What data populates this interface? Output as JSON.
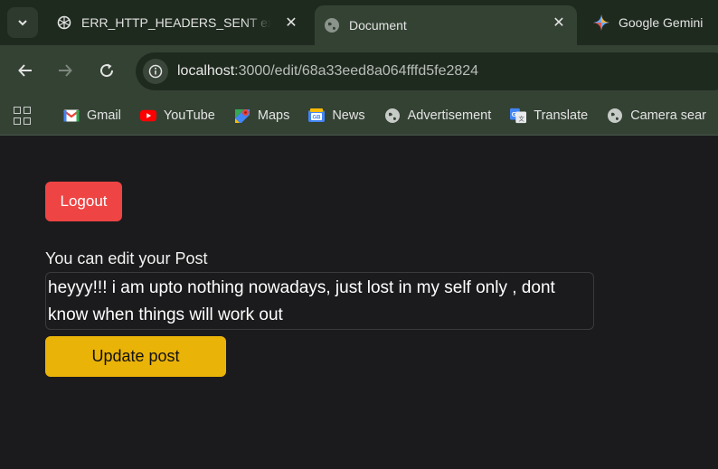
{
  "browser": {
    "tabs": [
      {
        "title": "ERR_HTTP_HEADERS_SENT expl",
        "icon": "chatgpt-icon"
      },
      {
        "title": "Document",
        "icon": "globe-icon",
        "active": true
      },
      {
        "title": "Google Gemini",
        "icon": "gemini-icon"
      }
    ],
    "url": {
      "host": "localhost",
      "path": ":3000/edit/68a33eed8a064fffd5fe2824"
    },
    "bookmarks": [
      {
        "label": "Gmail",
        "icon": "gmail-icon"
      },
      {
        "label": "YouTube",
        "icon": "youtube-icon"
      },
      {
        "label": "Maps",
        "icon": "maps-icon"
      },
      {
        "label": "News",
        "icon": "news-icon"
      },
      {
        "label": "Advertisement",
        "icon": "globe-icon"
      },
      {
        "label": "Translate",
        "icon": "translate-icon"
      },
      {
        "label": "Camera sear",
        "icon": "globe-icon"
      }
    ]
  },
  "page": {
    "logout_label": "Logout",
    "edit_label": "You can edit your Post",
    "post_content": "heyyy!!! i am upto nothing nowadays, just lost in my self only , dont know when things will work out",
    "update_label": "Update post"
  },
  "colors": {
    "logout_bg": "#ef4444",
    "update_bg": "#eab308",
    "page_bg": "#1b1b1d",
    "chrome_bg": "#344234"
  }
}
